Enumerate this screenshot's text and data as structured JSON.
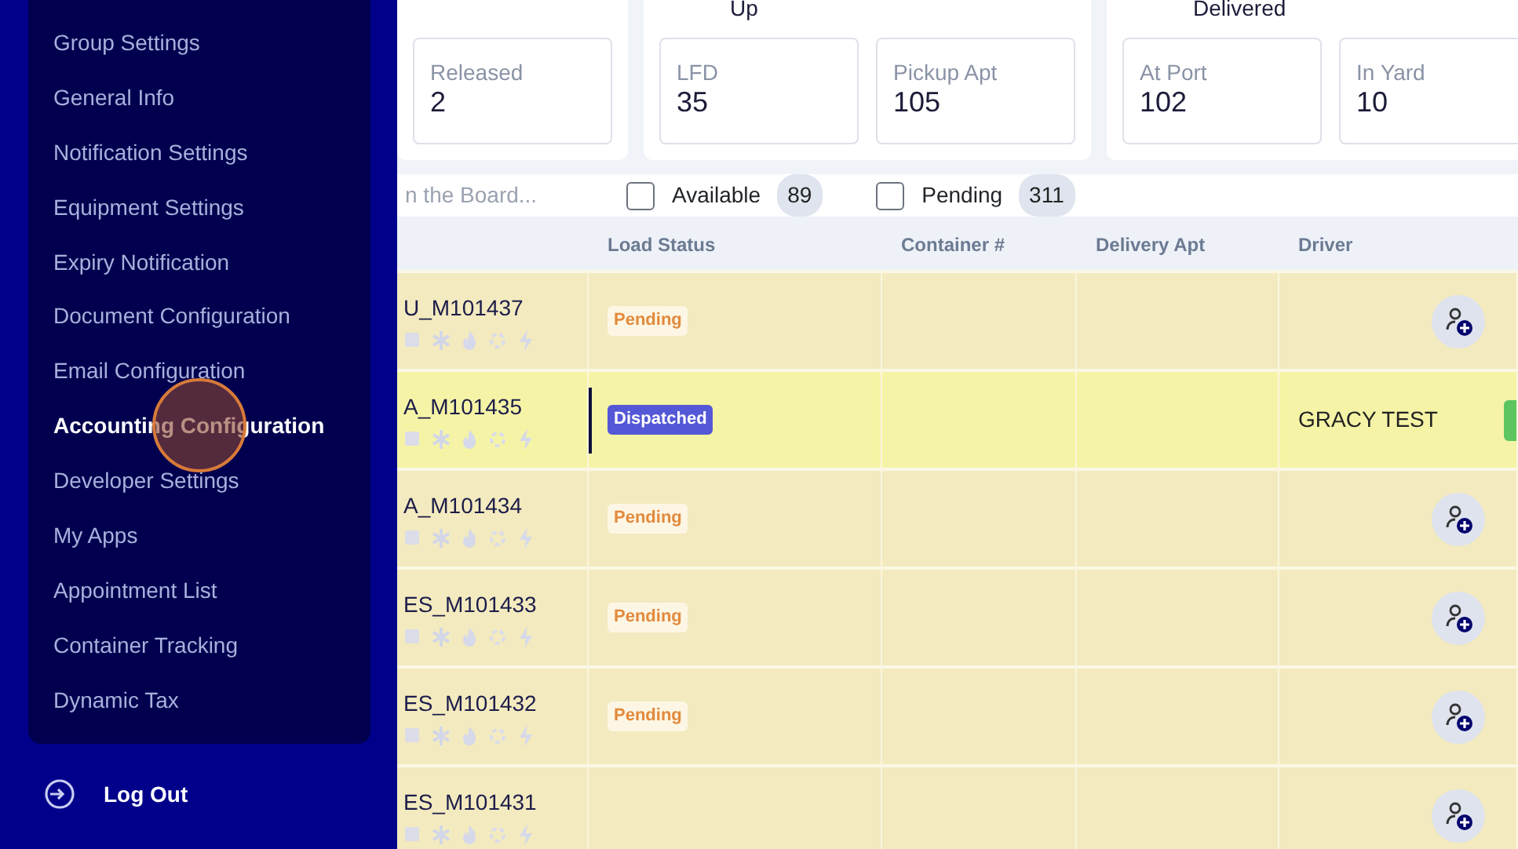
{
  "sidebar": {
    "items": [
      {
        "label": "Group Settings",
        "selected": false
      },
      {
        "label": "General Info",
        "selected": false
      },
      {
        "label": "Notification Settings",
        "selected": false
      },
      {
        "label": "Equipment Settings",
        "selected": false
      },
      {
        "label": "Expiry Notification",
        "selected": false
      },
      {
        "label": "Document Configuration",
        "selected": false
      },
      {
        "label": "Email Configuration",
        "selected": false
      },
      {
        "label": "Accounting Configuration",
        "selected": true
      },
      {
        "label": "Developer Settings",
        "selected": false
      },
      {
        "label": "My Apps",
        "selected": false
      },
      {
        "label": "Appointment List",
        "selected": false
      },
      {
        "label": "Container Tracking",
        "selected": false
      },
      {
        "label": "Dynamic Tax",
        "selected": false
      }
    ],
    "logout": "Log Out"
  },
  "summary": [
    {
      "cards": [
        {
          "label": "Released",
          "value": "2"
        }
      ]
    },
    {
      "heading": "Up",
      "cards": [
        {
          "label": "LFD",
          "value": "35"
        },
        {
          "label": "Pickup Apt",
          "value": "105"
        }
      ]
    },
    {
      "heading": "Delivered",
      "cards": [
        {
          "label": "At Port",
          "value": "102"
        },
        {
          "label": "In Yard",
          "value": "10"
        }
      ]
    }
  ],
  "filters": {
    "search": {
      "placeholder": "n the Board..."
    },
    "checks": [
      {
        "label": "Available",
        "count": "89",
        "checked": false
      },
      {
        "label": "Pending",
        "count": "311",
        "checked": false
      }
    ]
  },
  "table": {
    "columns": [
      null,
      "Load Status",
      "Container #",
      "Delivery Apt",
      "Driver"
    ],
    "rows": [
      {
        "load_id": "U_M101437",
        "status": "Pending",
        "kind": "pending",
        "driver": "",
        "selected": false
      },
      {
        "load_id": "A_M101435",
        "status": "Dispatched",
        "kind": "dispatched",
        "driver": "GRACY TEST",
        "selected": true
      },
      {
        "load_id": "A_M101434",
        "status": "Pending",
        "kind": "pending",
        "driver": "",
        "selected": false
      },
      {
        "load_id": "ES_M101433",
        "status": "Pending",
        "kind": "pending",
        "driver": "",
        "selected": false
      },
      {
        "load_id": "ES_M101432",
        "status": "Pending",
        "kind": "pending",
        "driver": "",
        "selected": false
      },
      {
        "load_id": "ES_M101431",
        "driver": "",
        "selected": false
      }
    ]
  }
}
